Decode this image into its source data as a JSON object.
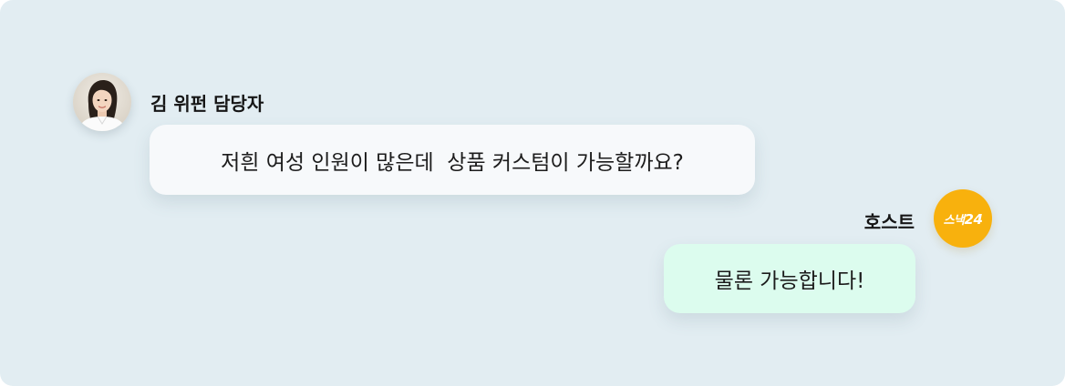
{
  "conversation": {
    "guest": {
      "name": "김 위펀 담당자",
      "avatar_icon": "person-avatar",
      "message": "저흰 여성 인원이 많은데  상품 커스텀이 가능할까요?"
    },
    "host": {
      "name": "호스트",
      "logo_text": "스낵",
      "logo_number": "24",
      "logo_color": "#f8b10d",
      "message": "물론 가능합니다!"
    }
  },
  "colors": {
    "background": "#e2edf2",
    "guest_bubble": "#f7f9fb",
    "host_bubble": "#dcfcee"
  }
}
